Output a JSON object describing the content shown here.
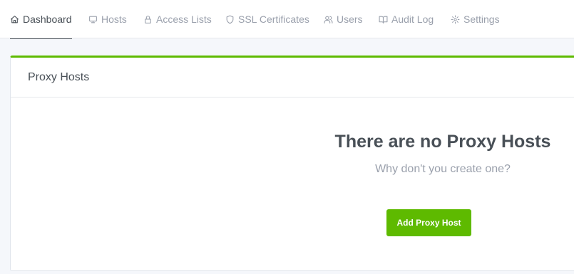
{
  "nav": {
    "items": [
      {
        "label": "Dashboard",
        "icon": "home-icon",
        "active": true
      },
      {
        "label": "Hosts",
        "icon": "monitor-icon",
        "active": false
      },
      {
        "label": "Access Lists",
        "icon": "lock-icon",
        "active": false
      },
      {
        "label": "SSL Certificates",
        "icon": "shield-icon",
        "active": false
      },
      {
        "label": "Users",
        "icon": "users-icon",
        "active": false
      },
      {
        "label": "Audit Log",
        "icon": "book-icon",
        "active": false
      },
      {
        "label": "Settings",
        "icon": "gear-icon",
        "active": false
      }
    ]
  },
  "card": {
    "title": "Proxy Hosts",
    "accent_color": "#5eba00",
    "empty_title": "There are no Proxy Hosts",
    "empty_subtitle": "Why don't you create one?",
    "add_button_label": "Add Proxy Host"
  }
}
